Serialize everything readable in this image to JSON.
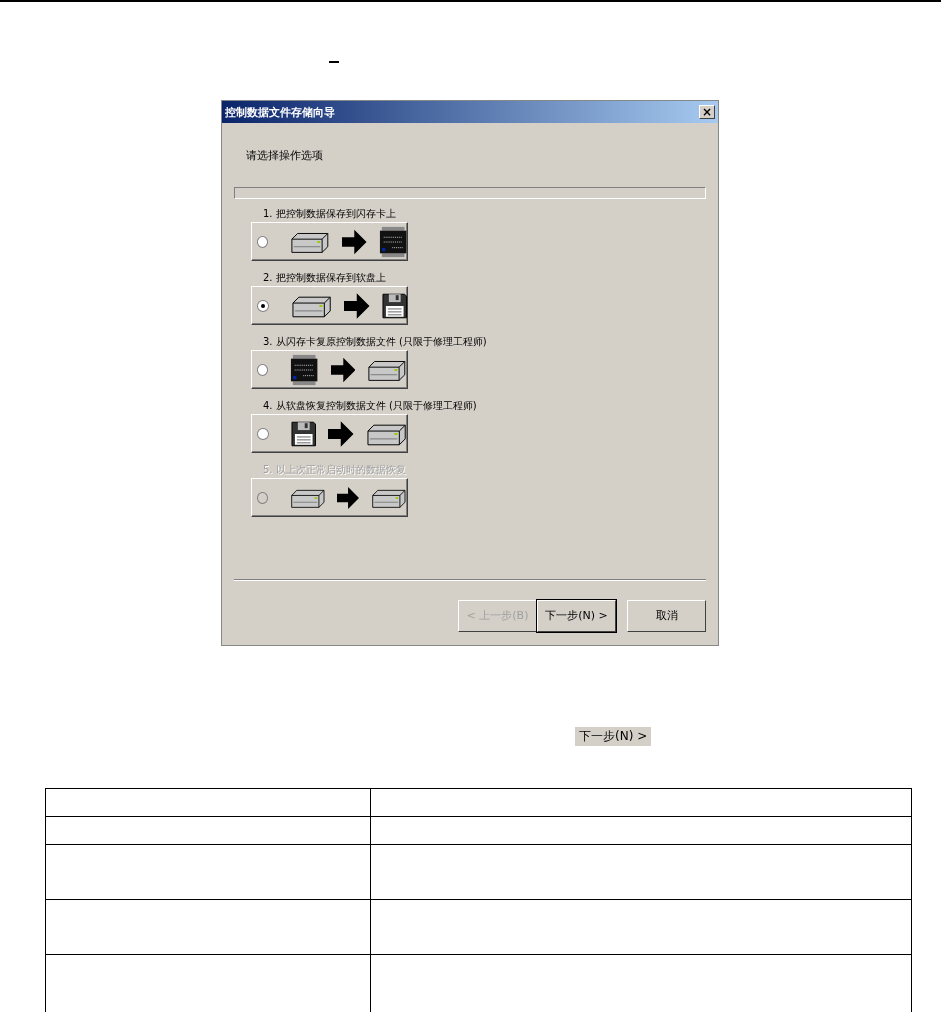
{
  "dialog": {
    "title": "控制数据文件存储向导",
    "close": "×",
    "prompt": "请选择操作选项",
    "options": [
      {
        "label": "1. 把控制数据保存到闪存卡上",
        "selected": false,
        "disabled": false,
        "source": {
          "kind": "drive"
        },
        "target": {
          "kind": "flash"
        }
      },
      {
        "label": "2. 把控制数据保存到软盘上",
        "selected": true,
        "disabled": false,
        "source": {
          "kind": "drive"
        },
        "target": {
          "kind": "floppy"
        }
      },
      {
        "label": "3. 从闪存卡复原控制数据文件 (只限于修理工程师)",
        "selected": false,
        "disabled": false,
        "source": {
          "kind": "flash"
        },
        "target": {
          "kind": "drive"
        }
      },
      {
        "label": "4. 从软盘恢复控制数据文件 (只限于修理工程师)",
        "selected": false,
        "disabled": false,
        "source": {
          "kind": "floppy"
        },
        "target": {
          "kind": "drive"
        }
      },
      {
        "label": "5. 以上次正常启动时的数据恢复",
        "selected": false,
        "disabled": true,
        "source": {
          "kind": "drive"
        },
        "target": {
          "kind": "drive"
        }
      }
    ],
    "buttons": [
      {
        "label": "< 上一步(B)",
        "disabled": true,
        "default": false
      },
      {
        "label": "下一步(N) >",
        "disabled": false,
        "default": true
      },
      {
        "label": "取消",
        "disabled": false,
        "default": false
      }
    ]
  },
  "inline_button": {
    "label": "下一步(N) >"
  }
}
